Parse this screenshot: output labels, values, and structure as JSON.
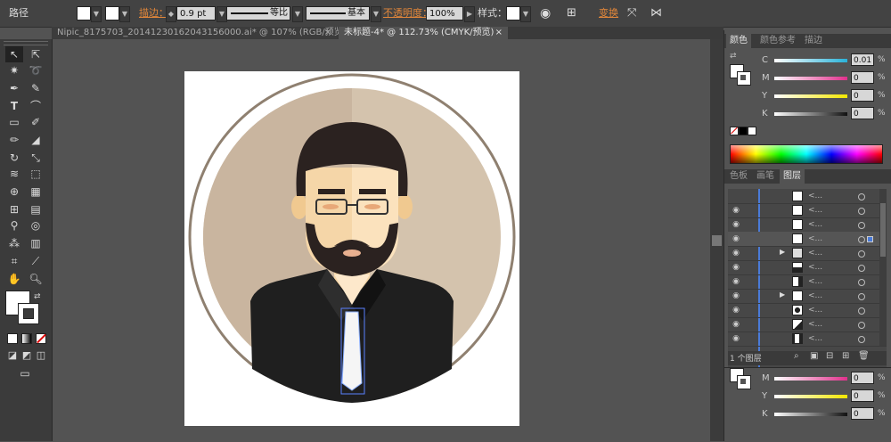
{
  "control_bar": {
    "object_type": "路径",
    "stroke_label": "描边：",
    "stroke_weight": "0.9 pt",
    "profile_label": "等比",
    "brush_label": "基本",
    "opacity_label": "不透明度：",
    "opacity_value": "100%",
    "style_label": "样式：",
    "transform_label": "变换"
  },
  "document_tabs": [
    {
      "label": "Nipic_8175703_20141230162043156000.ai* @ 107% (RGB/预览)"
    },
    {
      "label": "未标题-4* @ 112.73% (CMYK/预览)"
    }
  ],
  "color_panel": {
    "tabs": [
      "颜色",
      "颜色参考",
      "描边"
    ],
    "sliders": [
      {
        "label": "C",
        "value": "0.01",
        "unit": "%",
        "color": "#2ab2d8"
      },
      {
        "label": "M",
        "value": "0",
        "unit": "%",
        "color": "#e0308c"
      },
      {
        "label": "Y",
        "value": "0",
        "unit": "%",
        "color": "#f2e600"
      },
      {
        "label": "K",
        "value": "0",
        "unit": "%",
        "color": "#888888"
      }
    ]
  },
  "layers_panel": {
    "tabs": [
      "色板",
      "画笔",
      "图层"
    ],
    "rows": [
      "<...",
      "<...",
      "<...",
      "<...",
      "<...",
      "<...",
      "<...",
      "<...",
      "<...",
      "<...",
      "<..."
    ],
    "footer_text": "1 个图层"
  },
  "bottom_panel": {
    "sliders": [
      {
        "label": "M",
        "value": "0",
        "unit": "%",
        "color": "#e0308c"
      },
      {
        "label": "Y",
        "value": "0",
        "unit": "%",
        "color": "#f2e600"
      },
      {
        "label": "K",
        "value": "0",
        "unit": "%",
        "color": "#888888"
      }
    ]
  },
  "colors": {
    "skin": "#f5d6a8",
    "hair": "#2b2220",
    "suit": "#1f1f1f",
    "bg_circle": "#d4c3ad",
    "ring": "#8f8070"
  }
}
